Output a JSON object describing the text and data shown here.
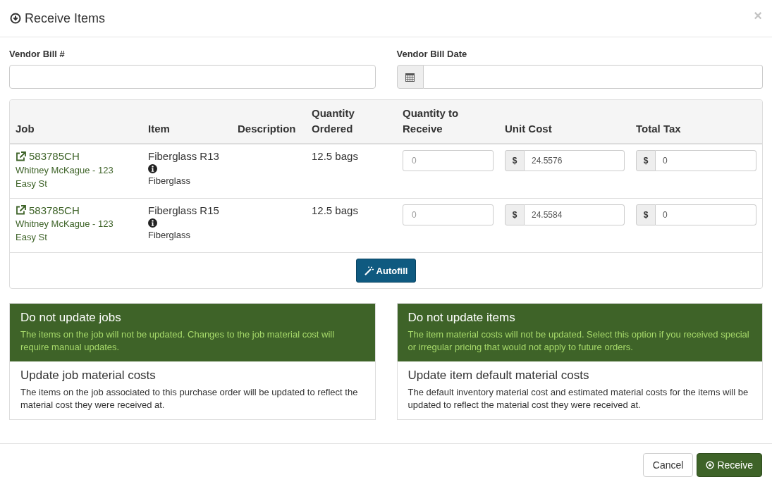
{
  "window": {
    "title": "Receive Items",
    "close": "×"
  },
  "fields": [
    {
      "kind": "text",
      "label": "Vendor Bill #"
    },
    {
      "kind": "date",
      "label": "Vendor Bill Date"
    }
  ],
  "table": {
    "columns": [
      "Job",
      "Item",
      "Description",
      "Quantity Ordered",
      "Quantity to Receive",
      "Unit Cost",
      "Total Tax"
    ],
    "rows": [
      {
        "job": "583785CH",
        "customer": "Whitney McKague - 123 Easy St",
        "item": "Fiberglass R13",
        "category": "Fiberglass",
        "qty_ordered": "12.5 bags",
        "qty_receive": {
          "placeholder": "0"
        },
        "unit_cost": {
          "prefix": "$",
          "value": "24.5576"
        },
        "total_tax": {
          "prefix": "$",
          "value": "0"
        }
      },
      {
        "job": "583785CH",
        "customer": "Whitney McKague - 123 Easy St",
        "item": "Fiberglass R15",
        "category": "Fiberglass",
        "qty_ordered": "12.5 bags",
        "qty_receive": {
          "placeholder": "0"
        },
        "unit_cost": {
          "prefix": "$",
          "value": "24.5584"
        },
        "total_tax": {
          "prefix": "$",
          "value": "0"
        }
      }
    ],
    "autofill_button": "Autofill"
  },
  "option_groups": [
    {
      "options": [
        {
          "title": "Do not update jobs",
          "description": "The items on the job will not be updated. Changes to the job material cost will require manual updates.",
          "selected": true
        },
        {
          "title": "Update job material costs",
          "description": "The items on the job associated to this purchase order will be updated to reflect the material cost they were received at.",
          "selected": false
        }
      ]
    },
    {
      "options": [
        {
          "title": "Do not update items",
          "description": "The item material costs will not be updated. Select this option if you received special or irregular pricing that would not apply to future orders.",
          "selected": true
        },
        {
          "title": "Update item default material costs",
          "description": "The default inventory material cost and estimated material costs for the items will be updated to reflect the material cost they were received at.",
          "selected": false
        }
      ]
    }
  ],
  "footer": {
    "cancel": "Cancel",
    "submit": "Receive"
  }
}
